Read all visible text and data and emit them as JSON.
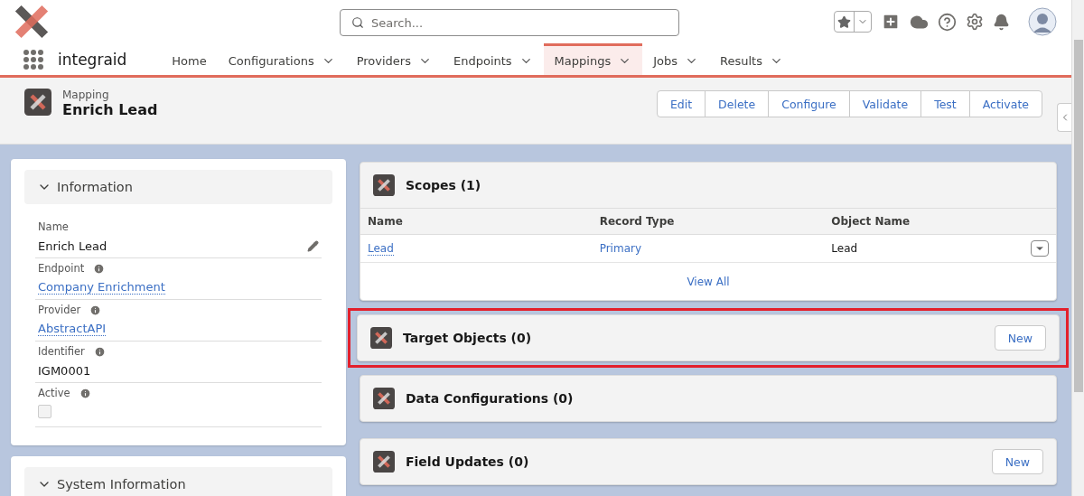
{
  "app": {
    "name": "integraid"
  },
  "search": {
    "placeholder": "Search..."
  },
  "nav": [
    {
      "label": "Home",
      "menu": false,
      "selected": false
    },
    {
      "label": "Configurations",
      "menu": true,
      "selected": false
    },
    {
      "label": "Providers",
      "menu": true,
      "selected": false
    },
    {
      "label": "Endpoints",
      "menu": true,
      "selected": false
    },
    {
      "label": "Mappings",
      "menu": true,
      "selected": true
    },
    {
      "label": "Jobs",
      "menu": true,
      "selected": false
    },
    {
      "label": "Results",
      "menu": true,
      "selected": false
    }
  ],
  "record": {
    "type": "Mapping",
    "title": "Enrich Lead",
    "actions": [
      "Edit",
      "Delete",
      "Configure",
      "Validate",
      "Test",
      "Activate"
    ]
  },
  "information": {
    "title": "Information",
    "expanded": true,
    "fields": [
      {
        "label": "Name",
        "kind": "text",
        "value": "Enrich Lead",
        "info": false,
        "editable": true
      },
      {
        "label": "Endpoint",
        "kind": "link",
        "value": "Company Enrichment",
        "info": true,
        "editable": false
      },
      {
        "label": "Provider",
        "kind": "link",
        "value": "AbstractAPI",
        "info": true,
        "editable": false
      },
      {
        "label": "Identifier",
        "kind": "text",
        "value": "IGM0001",
        "info": true,
        "editable": false
      },
      {
        "label": "Active",
        "kind": "checkbox",
        "checked": false,
        "info": true,
        "editable": false
      }
    ]
  },
  "system_information": {
    "title": "System Information",
    "expanded": true
  },
  "related": [
    {
      "kind": "table",
      "title": "Scopes (1)",
      "highlighted": false,
      "columns": [
        "Name",
        "Record Type",
        "Object Name"
      ],
      "rows": [
        {
          "cells": [
            {
              "kind": "record-link",
              "text": "Lead"
            },
            {
              "kind": "link",
              "text": "Primary"
            },
            {
              "kind": "text",
              "text": "Lead"
            }
          ]
        }
      ],
      "footer": "View All"
    },
    {
      "kind": "header",
      "title": "Target Objects (0)",
      "highlighted": true,
      "button": "New"
    },
    {
      "kind": "header",
      "title": "Data Configurations (0)",
      "highlighted": false
    },
    {
      "kind": "header",
      "title": "Field Updates (0)",
      "highlighted": false,
      "button": "New"
    }
  ]
}
